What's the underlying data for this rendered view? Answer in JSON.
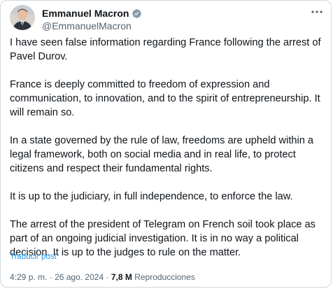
{
  "user": {
    "display_name": "Emmanuel Macron",
    "handle": "@EmmanuelMacron"
  },
  "icons": {
    "verified": "verified-badge-icon",
    "more": "more-horizontal-icon",
    "avatar": "profile-photo"
  },
  "colors": {
    "verified_badge": "#829aab",
    "link": "#1d9bf0",
    "secondary_text": "#536471",
    "border": "#cfd9de"
  },
  "tweet": {
    "paragraphs": [
      "I have seen false information regarding France following the arrest of Pavel Durov.",
      "France is deeply committed to freedom of expression and communication, to innovation, and to the spirit of entrepreneurship. It will remain so.",
      "In a state governed by the rule of law, freedoms are upheld within a legal framework, both on social media and in real life, to protect citizens and respect their fundamental rights.",
      "It is up to the judiciary, in full independence, to enforce the law.",
      "The arrest of the president of Telegram on French soil took place as part of an ongoing judicial investigation. It is in no way a political decision. It is up to the judges to rule on the matter."
    ],
    "translate_label": "Traducir post",
    "time": "4:29 p. m.",
    "separator": "·",
    "date": "26 ago. 2024",
    "views_count": "7,8 M",
    "views_label": "Reproducciones"
  }
}
